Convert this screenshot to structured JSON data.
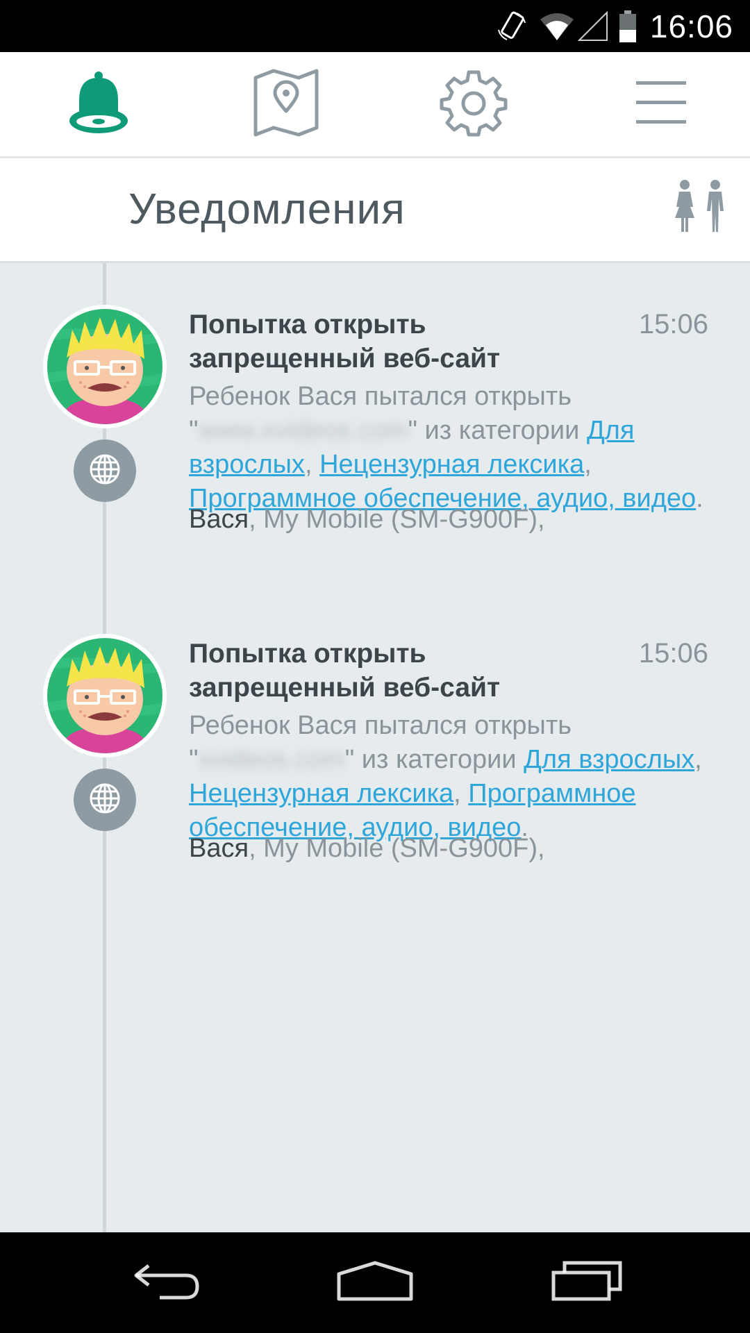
{
  "status_bar": {
    "time": "16:06",
    "icons": [
      "rotate-icon",
      "wifi-icon",
      "signal-icon",
      "battery-icon"
    ]
  },
  "top_nav": {
    "items": [
      {
        "icon": "bell-icon",
        "active": true
      },
      {
        "icon": "map-pin-icon",
        "active": false
      },
      {
        "icon": "gear-icon",
        "active": false
      },
      {
        "icon": "hamburger-menu-icon",
        "active": false
      }
    ],
    "active_color": "#0f9a78",
    "inactive_color": "#8f9ba2"
  },
  "header": {
    "title": "Уведомления",
    "right_icon": "family-icon"
  },
  "notifications": [
    {
      "title": "Попытка открыть запрещенный веб-сайт",
      "time": "15:06",
      "body_prefix": "Ребенок Вася пытался открыть",
      "quote_open": "\"",
      "url_blurred": "www.xvideos.com",
      "quote_close": "\"",
      "body_middle": " из категории ",
      "categories": [
        "Для взрослых",
        "Нецензурная лексика",
        "Программное обеспечение, аудио, видео"
      ],
      "separator": ", ",
      "end": ".",
      "child_name": "Вася",
      "device": ", My Mobile (SM-G900F),",
      "category_icon": "globe-icon"
    },
    {
      "title": "Попытка открыть запрещенный веб-сайт",
      "time": "15:06",
      "body_prefix": "Ребенок Вася пытался открыть",
      "quote_open": "\"",
      "url_blurred": "xvideos.com",
      "quote_close": "\"",
      "body_middle": " из категории ",
      "categories": [
        "Для взрослых",
        "Нецензурная лексика",
        "Программное обеспечение, аудио, видео"
      ],
      "separator": ", ",
      "end": ".",
      "child_name": "Вася",
      "device": ", My Mobile (SM-G900F),",
      "category_icon": "globe-icon"
    }
  ],
  "system_nav": {
    "buttons": [
      "back-icon",
      "home-icon",
      "recents-icon"
    ]
  }
}
